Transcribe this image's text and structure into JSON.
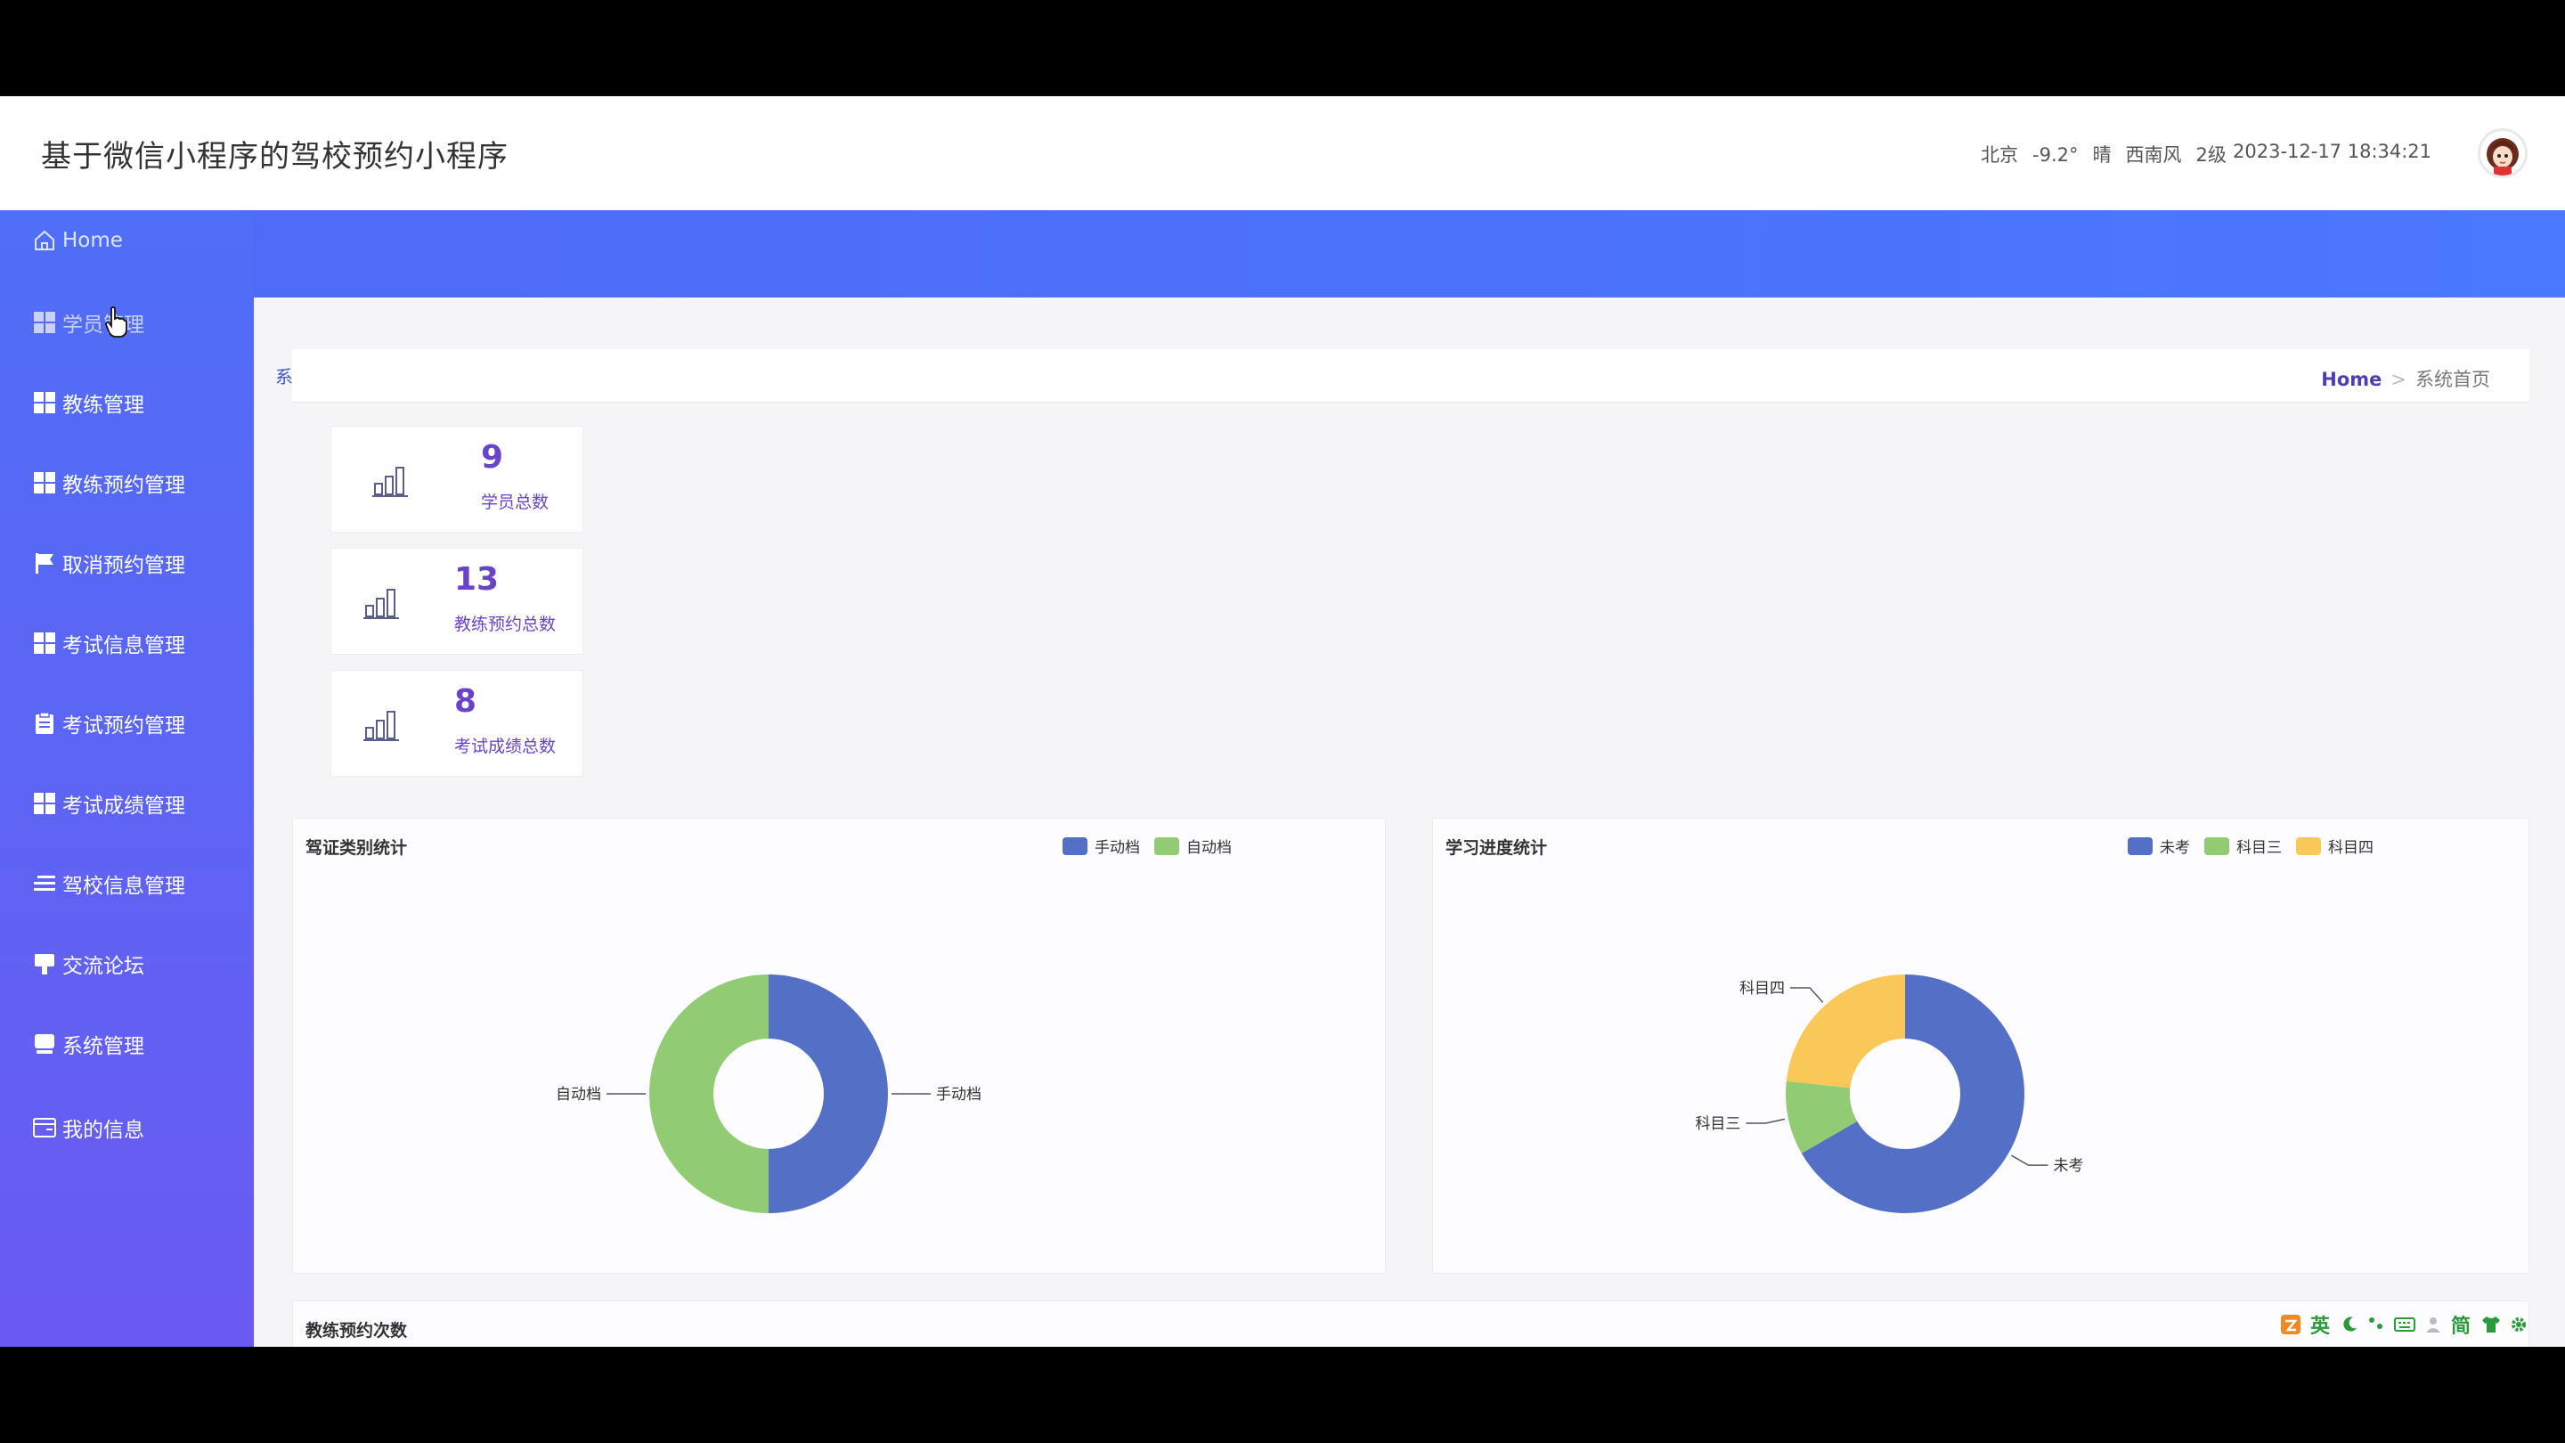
{
  "header": {
    "title": "基于微信小程序的驾校预约小程序",
    "weather": {
      "city": "北京",
      "temp": "-9.2°",
      "cond": "晴",
      "wind_dir": "西南风",
      "wind_level": "2级"
    },
    "datetime": "2023-12-17 18:34:21"
  },
  "sidebar": {
    "items": [
      {
        "label": "Home",
        "icon": "home-icon"
      },
      {
        "label": "学员管理",
        "icon": "grid-icon"
      },
      {
        "label": "教练管理",
        "icon": "grid-icon"
      },
      {
        "label": "教练预约管理",
        "icon": "grid-icon"
      },
      {
        "label": "取消预约管理",
        "icon": "flag-icon"
      },
      {
        "label": "考试信息管理",
        "icon": "grid-icon"
      },
      {
        "label": "考试预约管理",
        "icon": "clipboard-icon"
      },
      {
        "label": "考试成绩管理",
        "icon": "grid-icon"
      },
      {
        "label": "驾校信息管理",
        "icon": "list-icon"
      },
      {
        "label": "交流论坛",
        "icon": "chat-icon"
      },
      {
        "label": "系统管理",
        "icon": "monitor-icon"
      },
      {
        "label": "我的信息",
        "icon": "card-icon"
      }
    ]
  },
  "tabs": [
    {
      "label": "系统首页"
    }
  ],
  "breadcrumb": {
    "home": "Home",
    "separator": ">",
    "current": "系统首页"
  },
  "stats": [
    {
      "value": "9",
      "label": "学员总数"
    },
    {
      "value": "13",
      "label": "教练预约总数"
    },
    {
      "value": "8",
      "label": "考试成绩总数"
    }
  ],
  "colors": {
    "blue": "#5470c6",
    "green": "#91cc75",
    "yellow": "#fac858",
    "accent": "#6a44c8",
    "sidebar": "#5b66f4"
  },
  "chart_data": [
    {
      "type": "pie",
      "title": "驾证类别统计",
      "legend_position": "top-right",
      "slices": [
        {
          "name": "手动档",
          "value": 50,
          "color": "#5470c6"
        },
        {
          "name": "自动档",
          "value": 50,
          "color": "#91cc75"
        }
      ]
    },
    {
      "type": "pie",
      "title": "学习进度统计",
      "legend_position": "top-right",
      "slices": [
        {
          "name": "未考",
          "value": 66.7,
          "color": "#5470c6"
        },
        {
          "name": "科目三",
          "value": 10,
          "color": "#91cc75"
        },
        {
          "name": "科目四",
          "value": 23.3,
          "color": "#fac858"
        }
      ]
    }
  ],
  "bottom_panel": {
    "title": "教练预约次数"
  },
  "ime": {
    "lang": "英",
    "mode": "简"
  }
}
